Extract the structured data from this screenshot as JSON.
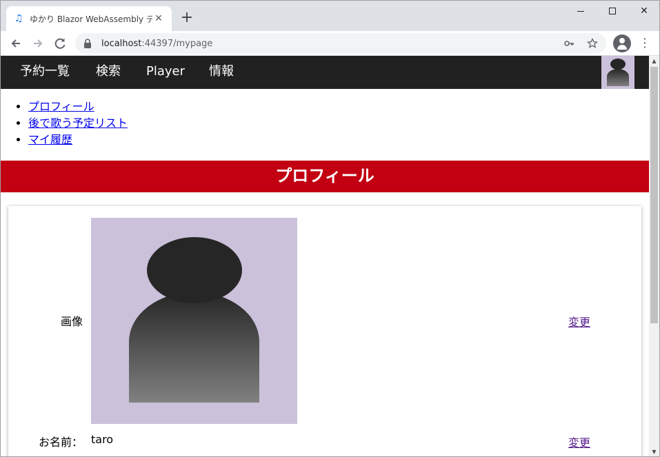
{
  "browser": {
    "tab_title": "ゆかり Blazor WebAssembly デモ",
    "url_host": "localhost",
    "url_path": ":44397/mypage"
  },
  "navbar": {
    "items": [
      {
        "label": "予約一覧"
      },
      {
        "label": "検索"
      },
      {
        "label": "Player"
      },
      {
        "label": "情報"
      }
    ]
  },
  "sublinks": [
    {
      "label": "プロフィール"
    },
    {
      "label": "後で歌う予定リスト"
    },
    {
      "label": "マイ履歴"
    }
  ],
  "section": {
    "title": "プロフィール"
  },
  "profile": {
    "image_label": "画像",
    "name_label": "お名前：",
    "name_value": "taro",
    "change_image_label": "変更",
    "change_name_label": "変更"
  },
  "colors": {
    "navbar_bg": "#212121",
    "section_bar_bg": "#c20012",
    "avatar_bg": "#cbc1db"
  }
}
